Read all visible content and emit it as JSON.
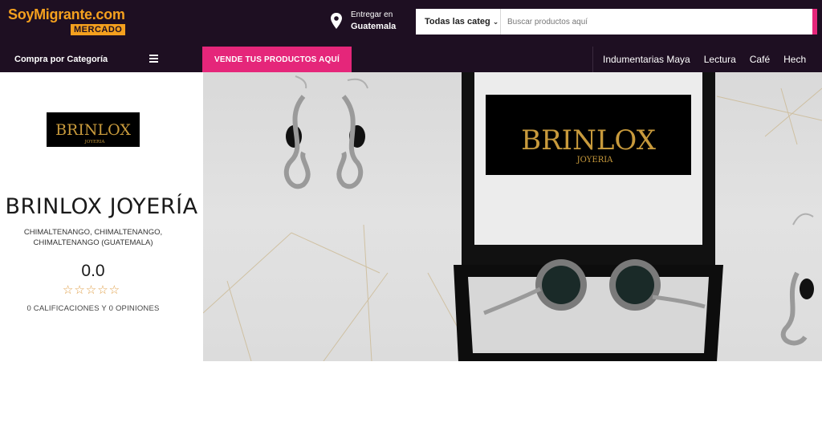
{
  "header": {
    "logo_main": "SoyMigrante.com",
    "logo_sub": "MERCADO",
    "deliver_label": "Entregar en",
    "deliver_city": "Guatemala",
    "search_category": "Todas las categ",
    "search_placeholder": "Buscar productos aquí"
  },
  "navbar": {
    "category_menu_label": "Compra por Categoría",
    "sell_button_label": "VENDE TUS PRODUCTOS AQUÍ",
    "links": [
      "Indumentarias Maya",
      "Lectura",
      "Café",
      "Hech"
    ]
  },
  "store": {
    "logo_text": "BRINLOX",
    "logo_subtext": "JOYERIA",
    "name": "BRINLOX JOYERÍA",
    "location_line1": "CHIMALTENANGO, CHIMALTENANGO,",
    "location_line2": "CHIMALTENANGO (GUATEMALA)",
    "rating": "0.0",
    "stars": "☆☆☆☆☆",
    "reviews": "0 CALIFICACIONES Y 0 OPINIONES"
  },
  "banner": {
    "box_logo_text": "BRINLOX",
    "box_logo_subtext": "JOYERIA"
  },
  "colors": {
    "header_bg": "#1e0f22",
    "brand_orange": "#f4a01e",
    "accent_pink": "#e5267a",
    "star_color": "#e0a04a",
    "logo_gold": "#c89a3c"
  },
  "icons": {
    "location": "map-pin-icon",
    "dropdown": "chevron-down-icon",
    "menu": "hamburger-icon",
    "rating": "star-outline-icon"
  }
}
